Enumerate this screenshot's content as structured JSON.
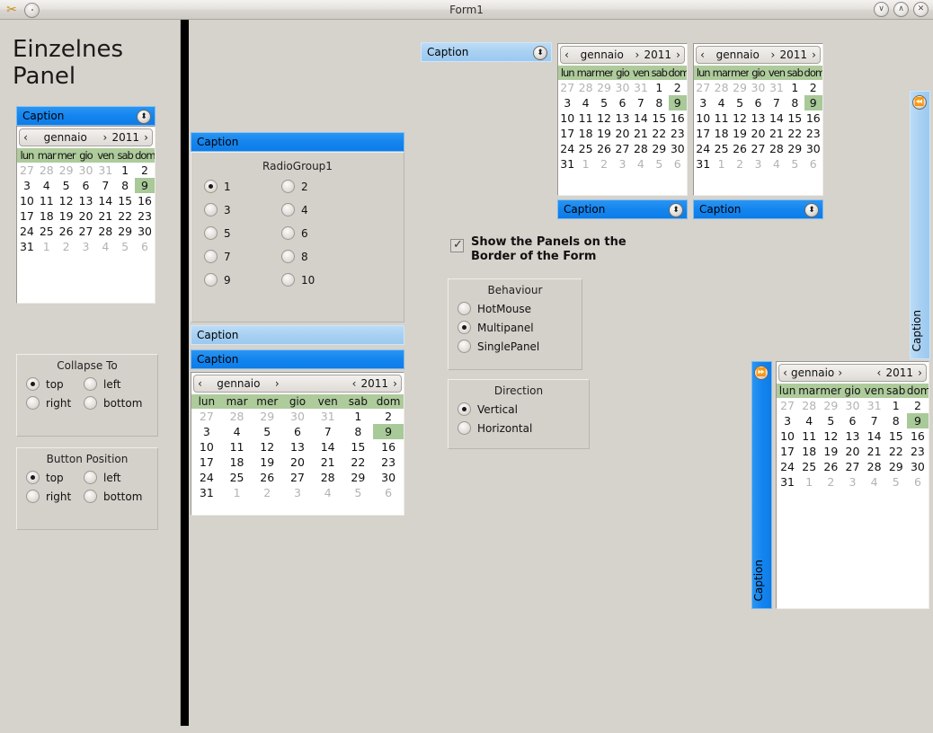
{
  "window": {
    "title": "Form1",
    "app_icon": "scissors-icon",
    "menu_icon": "dot-icon",
    "buttons": [
      {
        "name": "minimize",
        "glyph": "∨"
      },
      {
        "name": "maximize",
        "glyph": "∧"
      },
      {
        "name": "close",
        "glyph": "✕"
      }
    ]
  },
  "left_pane": {
    "heading": "Einzelnes Panel",
    "panel": {
      "caption": "Caption",
      "collapse_glyph": "⬍"
    },
    "collapse_group": {
      "title": "Collapse To",
      "options": [
        {
          "label": "top",
          "selected": true
        },
        {
          "label": "left",
          "selected": false
        },
        {
          "label": "right",
          "selected": false
        },
        {
          "label": "bottom",
          "selected": false
        }
      ]
    },
    "button_group": {
      "title": "Button Position",
      "options": [
        {
          "label": "top",
          "selected": true
        },
        {
          "label": "left",
          "selected": false
        },
        {
          "label": "right",
          "selected": false
        },
        {
          "label": "bottom",
          "selected": false
        }
      ]
    }
  },
  "mid_panel": {
    "caption_top": "Caption",
    "caption_middle": "Caption",
    "caption_bottom": "Caption",
    "radiogroup": {
      "title": "RadioGroup1",
      "options": [
        {
          "label": "1",
          "selected": true
        },
        {
          "label": "2",
          "selected": false
        },
        {
          "label": "3",
          "selected": false
        },
        {
          "label": "4",
          "selected": false
        },
        {
          "label": "5",
          "selected": false
        },
        {
          "label": "6",
          "selected": false
        },
        {
          "label": "7",
          "selected": false
        },
        {
          "label": "8",
          "selected": false
        },
        {
          "label": "9",
          "selected": false
        },
        {
          "label": "10",
          "selected": false
        }
      ]
    }
  },
  "top_caption_panel": {
    "caption": "Caption",
    "collapse_glyph": "⬍"
  },
  "right_strip": {
    "caption": "Caption",
    "collapse_glyph": "⏪"
  },
  "checkbox": {
    "label": "Show the Panels on the Border of the Form",
    "checked": true
  },
  "behaviour_group": {
    "title": "Behaviour",
    "options": [
      {
        "label": "HotMouse",
        "selected": false
      },
      {
        "label": "Multipanel",
        "selected": true
      },
      {
        "label": "SinglePanel",
        "selected": false
      }
    ]
  },
  "direction_group": {
    "title": "Direction",
    "options": [
      {
        "label": "Vertical",
        "selected": true
      },
      {
        "label": "Horizontal",
        "selected": false
      }
    ]
  },
  "bottom_right_panel": {
    "caption": "Caption",
    "collapse_glyph": "⏩"
  },
  "calendar": {
    "month": "gennaio",
    "year": "2011",
    "prev_glyph": "‹",
    "next_glyph": "›",
    "weekdays_long": [
      "lun",
      "mar",
      "mer",
      "gio",
      "ven",
      "sab",
      "dom"
    ],
    "weekdays_narrow": [
      "lun",
      "mar",
      "mer",
      "gio",
      "ven",
      "sab",
      "dom"
    ],
    "selected_day": 9,
    "weeks": [
      [
        {
          "d": "27",
          "out": true
        },
        {
          "d": "28",
          "out": true
        },
        {
          "d": "29",
          "out": true
        },
        {
          "d": "30",
          "out": true
        },
        {
          "d": "31",
          "out": true
        },
        {
          "d": "1",
          "out": false
        },
        {
          "d": "2",
          "out": false
        }
      ],
      [
        {
          "d": "3",
          "out": false
        },
        {
          "d": "4",
          "out": false
        },
        {
          "d": "5",
          "out": false
        },
        {
          "d": "6",
          "out": false
        },
        {
          "d": "7",
          "out": false
        },
        {
          "d": "8",
          "out": false
        },
        {
          "d": "9",
          "out": false,
          "sel": true
        }
      ],
      [
        {
          "d": "10",
          "out": false
        },
        {
          "d": "11",
          "out": false
        },
        {
          "d": "12",
          "out": false
        },
        {
          "d": "13",
          "out": false
        },
        {
          "d": "14",
          "out": false
        },
        {
          "d": "15",
          "out": false
        },
        {
          "d": "16",
          "out": false
        }
      ],
      [
        {
          "d": "17",
          "out": false
        },
        {
          "d": "18",
          "out": false
        },
        {
          "d": "19",
          "out": false
        },
        {
          "d": "20",
          "out": false
        },
        {
          "d": "21",
          "out": false
        },
        {
          "d": "22",
          "out": false
        },
        {
          "d": "23",
          "out": false
        }
      ],
      [
        {
          "d": "24",
          "out": false
        },
        {
          "d": "25",
          "out": false
        },
        {
          "d": "26",
          "out": false
        },
        {
          "d": "27",
          "out": false
        },
        {
          "d": "28",
          "out": false
        },
        {
          "d": "29",
          "out": false
        },
        {
          "d": "30",
          "out": false
        }
      ],
      [
        {
          "d": "31",
          "out": false
        },
        {
          "d": "1",
          "out": true
        },
        {
          "d": "2",
          "out": true
        },
        {
          "d": "3",
          "out": true
        },
        {
          "d": "4",
          "out": true
        },
        {
          "d": "5",
          "out": true
        },
        {
          "d": "6",
          "out": true
        }
      ]
    ]
  },
  "colors": {
    "caption_blue": "#1485ef",
    "caption_blue_light": "#a8d0f2",
    "weekday_green": "#aecb9c",
    "selected_green": "#a8c998",
    "face": "#d4d0ca",
    "window_bg": "#d6d2cc"
  }
}
